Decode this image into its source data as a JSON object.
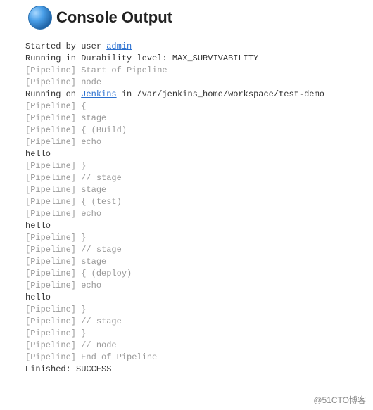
{
  "header": {
    "title": "Console Output",
    "icon_name": "blue-ball-icon"
  },
  "links": {
    "user_name": "admin",
    "jenkins_name": "Jenkins"
  },
  "console": {
    "started_prefix": "Started by user ",
    "durability_line": "Running in Durability level: MAX_SURVIVABILITY",
    "pipe_start": "[Pipeline] Start of Pipeline",
    "pipe_node": "[Pipeline] node",
    "running_prefix": "Running on ",
    "running_suffix": " in /var/jenkins_home/workspace/test-demo",
    "pipe_open": "[Pipeline] {",
    "pipe_stage": "[Pipeline] stage",
    "pipe_build_open": "[Pipeline] { (Build)",
    "pipe_echo": "[Pipeline] echo",
    "echo1": "hello",
    "pipe_close": "[Pipeline] }",
    "pipe_stage_end": "[Pipeline] // stage",
    "pipe_test_open": "[Pipeline] { (test)",
    "echo2": "hello",
    "pipe_deploy_open": "[Pipeline] { (deploy)",
    "echo3": "hello",
    "pipe_node_end": "[Pipeline] // node",
    "pipe_end": "[Pipeline] End of Pipeline",
    "finished": "Finished: SUCCESS"
  },
  "watermark": "@51CTO博客"
}
